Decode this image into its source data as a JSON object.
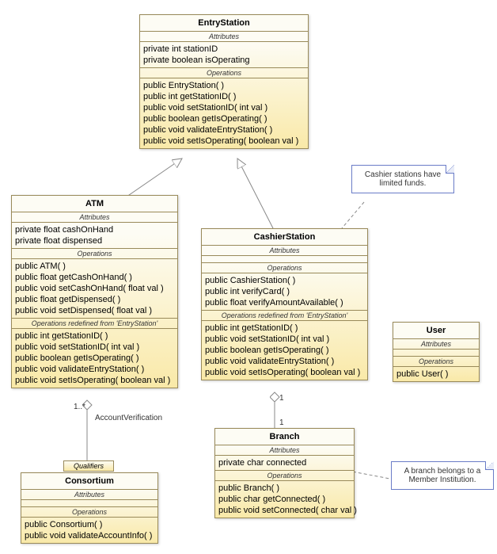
{
  "classes": {
    "entryStation": {
      "name": "EntryStation",
      "attrLabel": "Attributes",
      "attrs": [
        "private int stationID",
        "private boolean isOperating"
      ],
      "opLabel": "Operations",
      "ops": [
        "public EntryStation( )",
        "public int  getStationID( )",
        "public void  setStationID( int val )",
        "public boolean  getIsOperating( )",
        "public void  validateEntryStation( )",
        "public void  setIsOperating( boolean val )"
      ]
    },
    "atm": {
      "name": "ATM",
      "attrLabel": "Attributes",
      "attrs": [
        "private float cashOnHand",
        "private float dispensed"
      ],
      "opLabel": "Operations",
      "ops": [
        "public ATM( )",
        "public float  getCashOnHand( )",
        "public void  setCashOnHand( float val )",
        "public float  getDispensed( )",
        "public void  setDispensed( float val )"
      ],
      "redefLabel": "Operations redefined from 'EntryStation'",
      "redefOps": [
        "public int  getStationID( )",
        "public void  setStationID( int val )",
        "public boolean  getIsOperating( )",
        "public void  validateEntryStation( )",
        "public void  setIsOperating( boolean val )"
      ]
    },
    "cashier": {
      "name": "CashierStation",
      "attrLabel": "Attributes",
      "attrs": [],
      "opLabel": "Operations",
      "ops": [
        "public CashierStation( )",
        "public int  verifyCard( )",
        "public float  verifyAmountAvailable( )"
      ],
      "redefLabel": "Operations redefined from 'EntryStation'",
      "redefOps": [
        "public int  getStationID( )",
        "public void  setStationID( int val )",
        "public boolean  getIsOperating( )",
        "public void  validateEntryStation( )",
        "public void  setIsOperating( boolean val )"
      ]
    },
    "user": {
      "name": "User",
      "attrLabel": "Attributes",
      "attrs": [],
      "opLabel": "Operations",
      "ops": [
        "public User( )"
      ]
    },
    "branch": {
      "name": "Branch",
      "attrLabel": "Attributes",
      "attrs": [
        "private char connected"
      ],
      "opLabel": "Operations",
      "ops": [
        "public Branch( )",
        "public char  getConnected( )",
        "public void  setConnected( char val )"
      ]
    },
    "consortium": {
      "name": "Consortium",
      "attrLabel": "Attributes",
      "attrs": [],
      "opLabel": "Operations",
      "ops": [
        "public Consortium( )",
        "public void  validateAccountInfo( )"
      ]
    }
  },
  "notes": {
    "n1": "Cashier stations have limited funds.",
    "n2": "A branch belongs to a Member Institution."
  },
  "labels": {
    "assocName": "AccountVerification",
    "mult1": "1..*",
    "mult1b": "1",
    "mult1c": "1",
    "qualifiers": "Qualifiers"
  }
}
